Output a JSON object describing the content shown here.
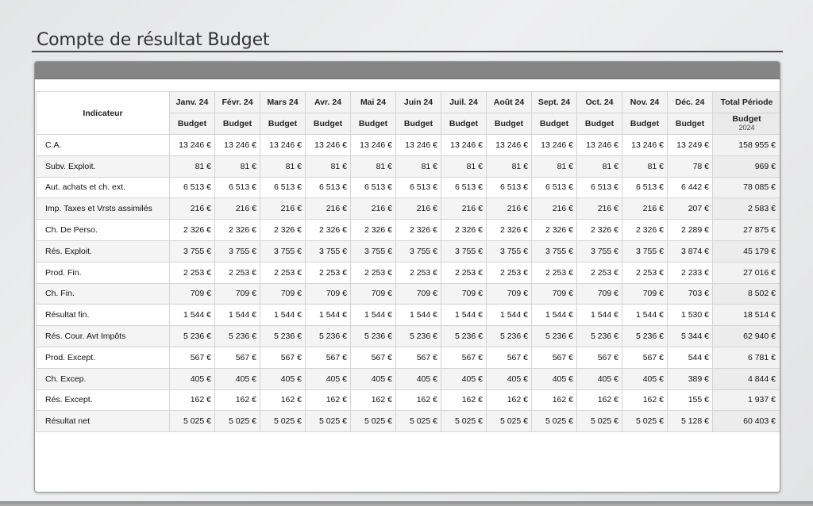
{
  "page": {
    "title": "Compte de résultat Budget"
  },
  "table": {
    "indicator_header": "Indicateur",
    "months": [
      "Janv. 24",
      "Févr. 24",
      "Mars 24",
      "Avr. 24",
      "Mai 24",
      "Juin 24",
      "Juil. 24",
      "Août 24",
      "Sept. 24",
      "Oct. 24",
      "Nov. 24",
      "Déc. 24"
    ],
    "sub_label": "Budget",
    "total_header": "Total Période",
    "total_sub": "Budget",
    "total_year": "2024",
    "rows": [
      {
        "label": "C.A.",
        "values": [
          "13 246 €",
          "13 246 €",
          "13 246 €",
          "13 246 €",
          "13 246 €",
          "13 246 €",
          "13 246 €",
          "13 246 €",
          "13 246 €",
          "13 246 €",
          "13 246 €",
          "13 249 €"
        ],
        "total": "158 955 €"
      },
      {
        "label": "Subv. Exploit.",
        "values": [
          "81 €",
          "81 €",
          "81 €",
          "81 €",
          "81 €",
          "81 €",
          "81 €",
          "81 €",
          "81 €",
          "81 €",
          "81 €",
          "78 €"
        ],
        "total": "969 €"
      },
      {
        "label": "Aut. achats et ch. ext.",
        "values": [
          "6 513 €",
          "6 513 €",
          "6 513 €",
          "6 513 €",
          "6 513 €",
          "6 513 €",
          "6 513 €",
          "6 513 €",
          "6 513 €",
          "6 513 €",
          "6 513 €",
          "6 442 €"
        ],
        "total": "78 085 €"
      },
      {
        "label": "Imp. Taxes et Vrsts assimilés",
        "values": [
          "216 €",
          "216 €",
          "216 €",
          "216 €",
          "216 €",
          "216 €",
          "216 €",
          "216 €",
          "216 €",
          "216 €",
          "216 €",
          "207 €"
        ],
        "total": "2 583 €"
      },
      {
        "label": "Ch. De Perso.",
        "values": [
          "2 326 €",
          "2 326 €",
          "2 326 €",
          "2 326 €",
          "2 326 €",
          "2 326 €",
          "2 326 €",
          "2 326 €",
          "2 326 €",
          "2 326 €",
          "2 326 €",
          "2 289 €"
        ],
        "total": "27 875 €"
      },
      {
        "label": "Rés. Exploit.",
        "values": [
          "3 755 €",
          "3 755 €",
          "3 755 €",
          "3 755 €",
          "3 755 €",
          "3 755 €",
          "3 755 €",
          "3 755 €",
          "3 755 €",
          "3 755 €",
          "3 755 €",
          "3 874 €"
        ],
        "total": "45 179 €"
      },
      {
        "label": "Prod. Fin.",
        "values": [
          "2 253 €",
          "2 253 €",
          "2 253 €",
          "2 253 €",
          "2 253 €",
          "2 253 €",
          "2 253 €",
          "2 253 €",
          "2 253 €",
          "2 253 €",
          "2 253 €",
          "2 233 €"
        ],
        "total": "27 016 €"
      },
      {
        "label": "Ch. Fin.",
        "values": [
          "709 €",
          "709 €",
          "709 €",
          "709 €",
          "709 €",
          "709 €",
          "709 €",
          "709 €",
          "709 €",
          "709 €",
          "709 €",
          "703 €"
        ],
        "total": "8 502 €"
      },
      {
        "label": "Résultat fin.",
        "values": [
          "1 544 €",
          "1 544 €",
          "1 544 €",
          "1 544 €",
          "1 544 €",
          "1 544 €",
          "1 544 €",
          "1 544 €",
          "1 544 €",
          "1 544 €",
          "1 544 €",
          "1 530 €"
        ],
        "total": "18 514 €"
      },
      {
        "label": "Rés. Cour. Avt Impôts",
        "values": [
          "5 236 €",
          "5 236 €",
          "5 236 €",
          "5 236 €",
          "5 236 €",
          "5 236 €",
          "5 236 €",
          "5 236 €",
          "5 236 €",
          "5 236 €",
          "5 236 €",
          "5 344 €"
        ],
        "total": "62 940 €"
      },
      {
        "label": "Prod. Except.",
        "values": [
          "567 €",
          "567 €",
          "567 €",
          "567 €",
          "567 €",
          "567 €",
          "567 €",
          "567 €",
          "567 €",
          "567 €",
          "567 €",
          "544 €"
        ],
        "total": "6 781 €"
      },
      {
        "label": "Ch. Excep.",
        "values": [
          "405 €",
          "405 €",
          "405 €",
          "405 €",
          "405 €",
          "405 €",
          "405 €",
          "405 €",
          "405 €",
          "405 €",
          "405 €",
          "389 €"
        ],
        "total": "4 844 €"
      },
      {
        "label": "Rés. Except.",
        "values": [
          "162 €",
          "162 €",
          "162 €",
          "162 €",
          "162 €",
          "162 €",
          "162 €",
          "162 €",
          "162 €",
          "162 €",
          "162 €",
          "155 €"
        ],
        "total": "1 937 €"
      },
      {
        "label": "Résultat net",
        "values": [
          "5 025 €",
          "5 025 €",
          "5 025 €",
          "5 025 €",
          "5 025 €",
          "5 025 €",
          "5 025 €",
          "5 025 €",
          "5 025 €",
          "5 025 €",
          "5 025 €",
          "5 128 €"
        ],
        "total": "60 403 €"
      }
    ]
  }
}
